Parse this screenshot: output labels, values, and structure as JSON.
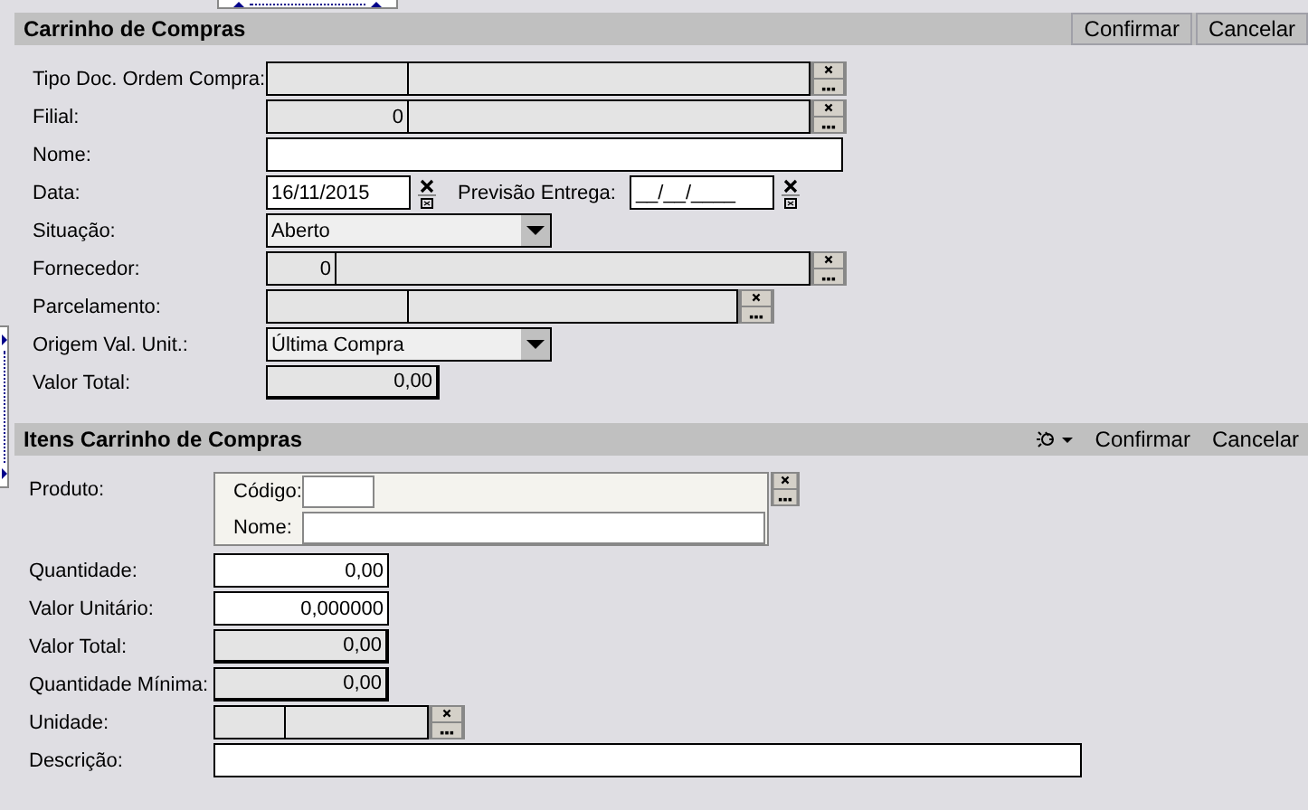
{
  "sections": [
    {
      "title": "Carrinho de Compras",
      "buttons": [
        "Confirmar",
        "Cancelar"
      ],
      "fields": [
        {
          "kind": "lookup",
          "label": "Tipo Doc. Ordem Compra:"
        },
        {
          "kind": "lookup",
          "label": "Filial:",
          "value": "0"
        },
        {
          "kind": "text",
          "label": "Nome:"
        },
        {
          "kind": "date_pair",
          "label": "Data:",
          "value": "16/11/2015",
          "second_label": "Previsão Entrega:",
          "second_value": "__/__/____"
        },
        {
          "kind": "select",
          "label": "Situação:",
          "value": "Aberto"
        },
        {
          "kind": "lookup",
          "label": "Fornecedor:",
          "value": "0"
        },
        {
          "kind": "lookup",
          "label": "Parcelamento:"
        },
        {
          "kind": "select",
          "label": "Origem Val. Unit.:",
          "value": "Última Compra"
        },
        {
          "kind": "number",
          "label": "Valor Total:",
          "value": "0,00",
          "readonly": true
        }
      ]
    },
    {
      "title": "Itens Carrinho de Compras",
      "buttons": [
        "Confirmar",
        "Cancelar"
      ],
      "fields": [
        {
          "kind": "product",
          "label": "Produto:",
          "code_label": "Código:",
          "name_label": "Nome:"
        },
        {
          "kind": "number",
          "label": "Quantidade:",
          "value": "0,00",
          "readonly": false
        },
        {
          "kind": "number",
          "label": "Valor Unitário:",
          "value": "0,000000",
          "readonly": false
        },
        {
          "kind": "number",
          "label": "Valor Total:",
          "value": "0,00",
          "readonly": true
        },
        {
          "kind": "number",
          "label": "Quantidade Mínima:",
          "value": "0,00",
          "readonly": true
        },
        {
          "kind": "lookup",
          "label": "Unidade:"
        },
        {
          "kind": "text",
          "label": "Descrição:"
        }
      ]
    }
  ]
}
